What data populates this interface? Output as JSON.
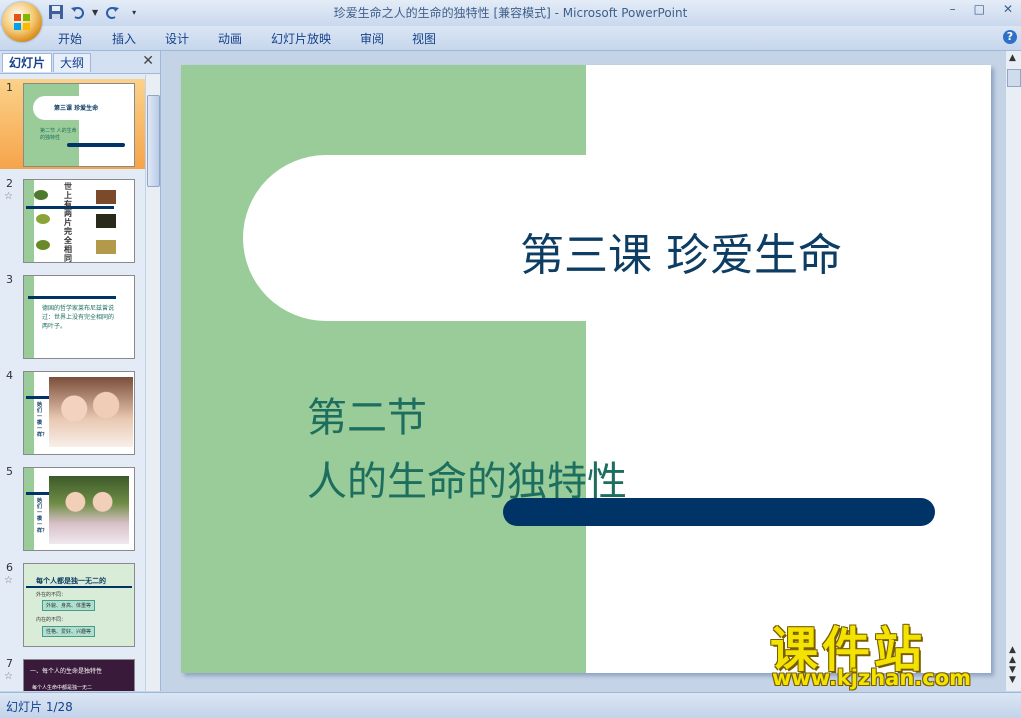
{
  "window": {
    "title": "珍爱生命之人的生命的独特性 [兼容模式] - Microsoft PowerPoint",
    "controls": [
      "–",
      "□",
      "✕"
    ]
  },
  "ribbon": {
    "tabs": [
      "开始",
      "插入",
      "设计",
      "动画",
      "幻灯片放映",
      "审阅",
      "视图"
    ],
    "help": "?"
  },
  "pane": {
    "tab_slides": "幻灯片",
    "tab_outline": "大纲",
    "close": "✕",
    "thumbnails": [
      {
        "num": "1",
        "star": "",
        "title": "第三课  珍爱生命",
        "sub": "第二节 人的生命的独特性"
      },
      {
        "num": "2",
        "star": "☆",
        "text": "世上有两片完全相同的叶子吗"
      },
      {
        "num": "3",
        "star": "",
        "text": "德国的哲学家莱布尼兹曾说过：世界上没有完全相同的两叶子。"
      },
      {
        "num": "4",
        "star": "",
        "text": "她们一模一样？"
      },
      {
        "num": "5",
        "star": "",
        "text": "她们一模一样？"
      },
      {
        "num": "6",
        "star": "☆",
        "title": "每个人都是独一无二的",
        "items": [
          "外在的不同：",
          "外貌、身高、体重等",
          "内在的不同：",
          "性格、爱好、兴趣等"
        ]
      },
      {
        "num": "7",
        "star": "☆",
        "title": "一、每个人的生命是独特性",
        "text": "每个人生命中都是独一无二"
      }
    ]
  },
  "slide": {
    "title": "第三课  珍爱生命",
    "subtitle_line1": "第二节",
    "subtitle_line2": "人的生命的独特性",
    "colors": {
      "left_panel": "#99cc99",
      "title": "#0d3d63",
      "subtitle": "#1d6e5e",
      "bar": "#003366"
    }
  },
  "watermark": {
    "cn": "课件站",
    "url": "www.kjzhan.com"
  },
  "status": {
    "text": "幻灯片 1/28"
  }
}
